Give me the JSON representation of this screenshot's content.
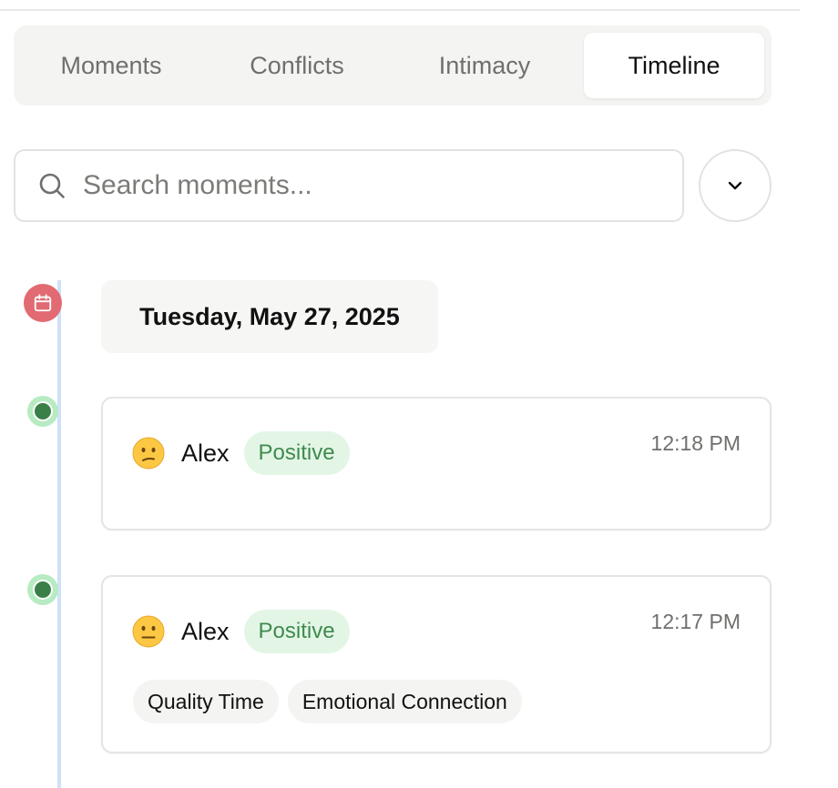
{
  "tabs": [
    {
      "label": "Moments"
    },
    {
      "label": "Conflicts"
    },
    {
      "label": "Intimacy"
    },
    {
      "label": "Timeline"
    }
  ],
  "active_tab": "Timeline",
  "search": {
    "placeholder": "Search moments...",
    "value": ""
  },
  "dropdown": {
    "icon": "chevron-down-icon"
  },
  "timeline": {
    "date_label": "Tuesday, May 27, 2025",
    "calendar_icon": "calendar-icon",
    "colors": {
      "line": "#cfe0f7",
      "calendar_dot": "#e26a72",
      "event_dot": "#3b7f48",
      "badge_bg": "#e3f6e6",
      "badge_text": "#3f8a4e"
    },
    "entries": [
      {
        "emoji": "confused-face-emoji",
        "author": "Alex",
        "sentiment": "Positive",
        "time": "12:18 PM",
        "tags": []
      },
      {
        "emoji": "neutral-face-emoji",
        "author": "Alex",
        "sentiment": "Positive",
        "time": "12:17 PM",
        "tags": [
          "Quality Time",
          "Emotional Connection"
        ]
      }
    ]
  }
}
